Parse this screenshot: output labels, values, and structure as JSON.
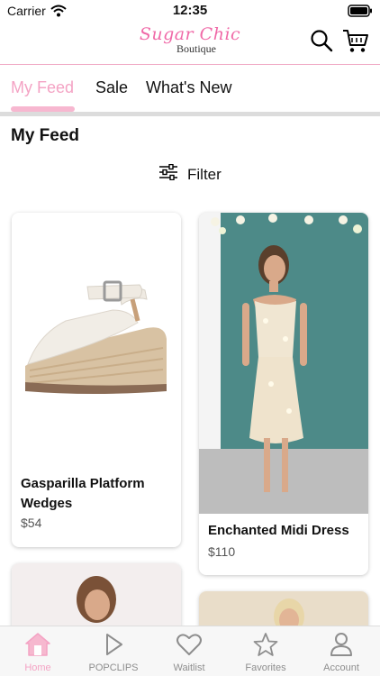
{
  "status_bar": {
    "carrier": "Carrier",
    "time": "12:35"
  },
  "header": {
    "logo_script": "Sugar Chic",
    "logo_sub": "Boutique",
    "search_icon": "search-icon",
    "cart_icon": "cart-icon"
  },
  "tabs": [
    {
      "label": "My Feed",
      "active": true
    },
    {
      "label": "Sale",
      "active": false
    },
    {
      "label": "What's New",
      "active": false
    }
  ],
  "page_title": "My Feed",
  "filter": {
    "label": "Filter",
    "icon": "sliders-icon"
  },
  "products": [
    {
      "name": "Gasparilla Platform Wedges",
      "price": "$54"
    },
    {
      "name": "Enchanted Midi Dress",
      "price": "$110"
    }
  ],
  "bottom_nav": [
    {
      "label": "Home",
      "icon": "home-icon",
      "active": true
    },
    {
      "label": "POPCLIPS",
      "icon": "play-icon",
      "active": false
    },
    {
      "label": "Waitlist",
      "icon": "heart-icon",
      "active": false
    },
    {
      "label": "Favorites",
      "icon": "star-icon",
      "active": false
    },
    {
      "label": "Account",
      "icon": "person-icon",
      "active": false
    }
  ],
  "colors": {
    "accent_pink": "#f4a3c4",
    "logo_pink": "#f06aa8",
    "inactive_gray": "#8e8e8e"
  }
}
